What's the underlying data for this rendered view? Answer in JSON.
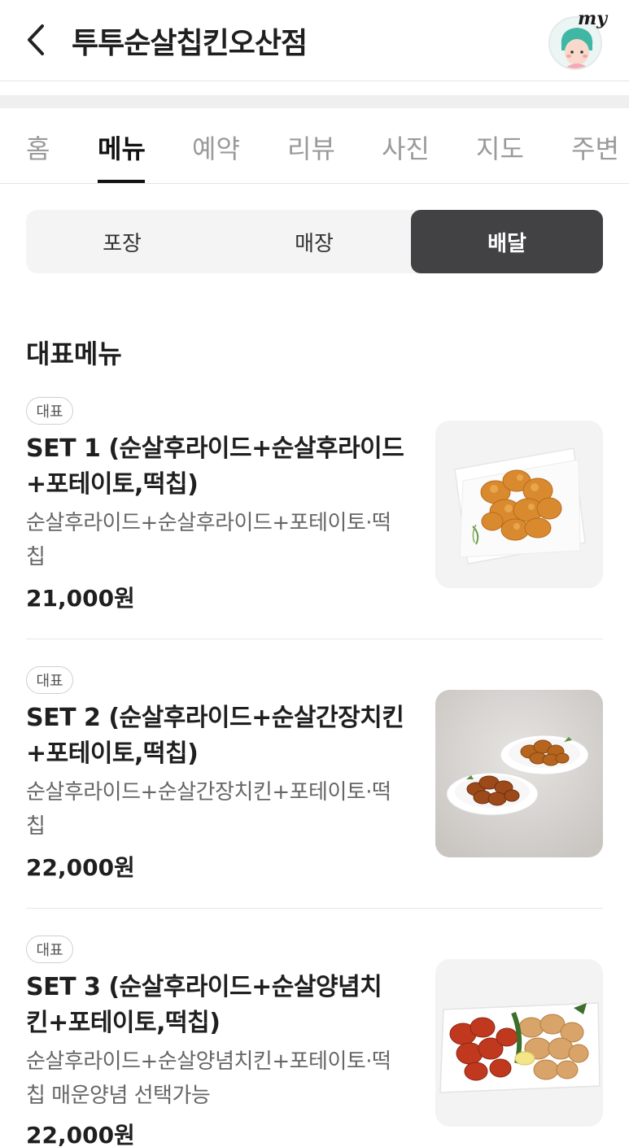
{
  "header": {
    "title": "투투순살칩킨오산점",
    "my_label": "my"
  },
  "tabs": [
    {
      "label": "홈"
    },
    {
      "label": "메뉴"
    },
    {
      "label": "예약"
    },
    {
      "label": "리뷰"
    },
    {
      "label": "사진"
    },
    {
      "label": "지도"
    },
    {
      "label": "주변"
    }
  ],
  "active_tab": "메뉴",
  "order_types": [
    {
      "label": "포장"
    },
    {
      "label": "매장"
    },
    {
      "label": "배달"
    }
  ],
  "active_order_type": "배달",
  "section": {
    "title": "대표메뉴"
  },
  "menu_items": [
    {
      "badge": "대표",
      "name_line1": "SET 1 (순살후라이드+순살후라이드",
      "name_line2": "+포테이토,떡칩)",
      "desc_line1": "순살후라이드+순살후라이드+포테이토·떡",
      "desc_line2": "칩",
      "price": "21,000원",
      "image": "fried-chicken-plate"
    },
    {
      "badge": "대표",
      "name_line1": "SET 2 (순살후라이드+순살간장치킨",
      "name_line2": "+포테이토,떡칩)",
      "desc_line1": "순살후라이드+순살간장치킨+포테이토·떡",
      "desc_line2": "칩",
      "price": "22,000원",
      "image": "soy-chicken-two-plates"
    },
    {
      "badge": "대표",
      "name_line1": "SET 3 (순살후라이드+순살양념치",
      "name_line2": "킨+포테이토,떡칩)",
      "desc_line1": "순살후라이드+순살양념치킨+포테이토·떡",
      "desc_line2": "칩 매운양념 선택가능",
      "price": "22,000원",
      "image": "half-and-half-chicken"
    }
  ],
  "colors": {
    "active_segment": "#424245",
    "tab_inactive": "#9a9a9a",
    "text_primary": "#1f1f1f"
  }
}
